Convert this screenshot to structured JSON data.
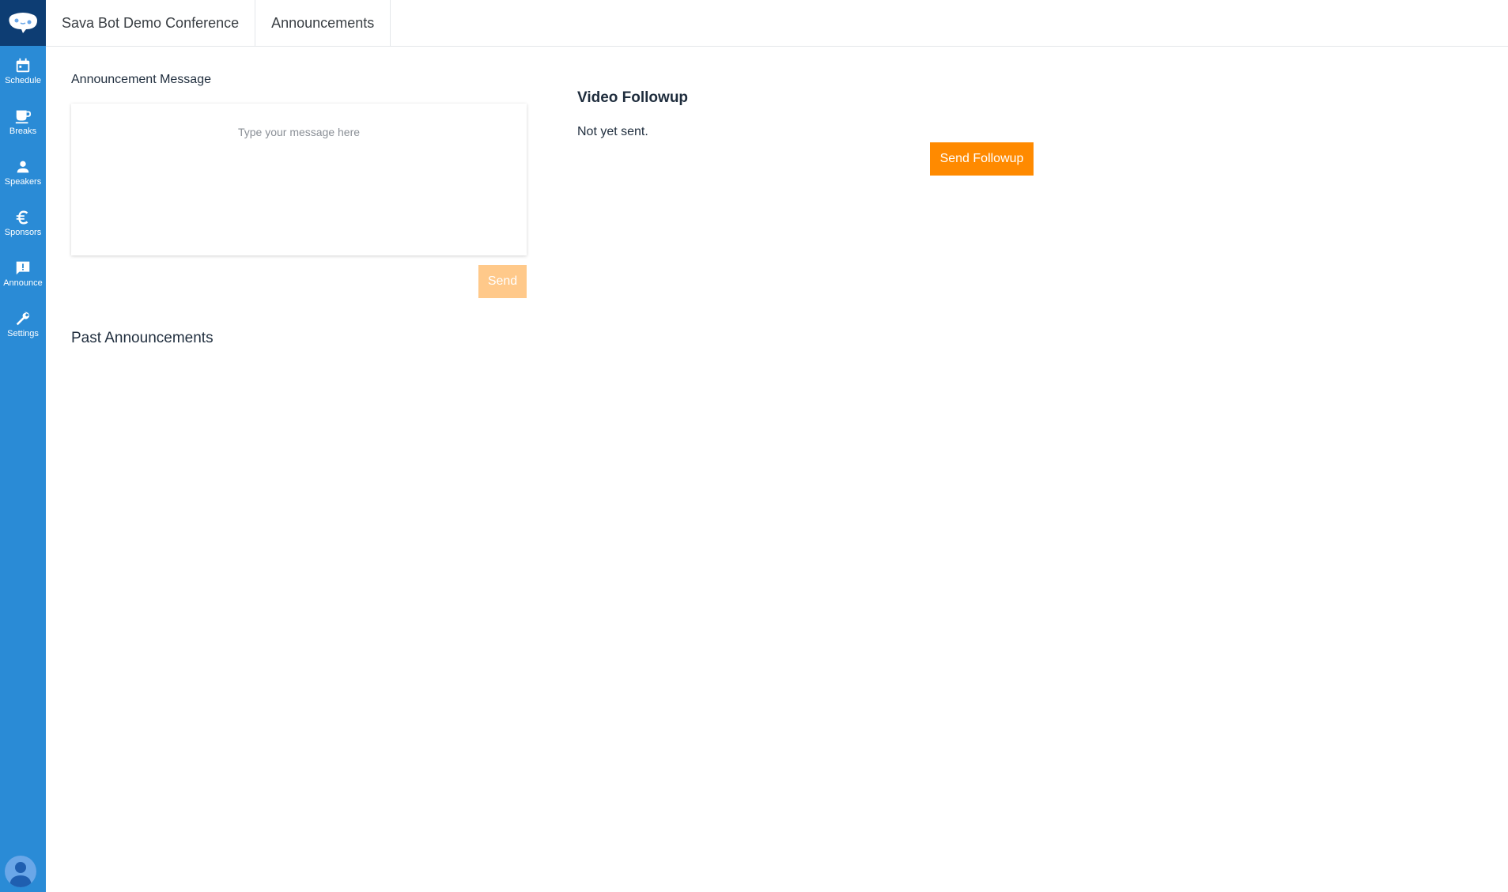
{
  "colors": {
    "sidebar": "#2a8bd6",
    "logo_bg": "#0d3d73",
    "accent": "#ff8a00",
    "accent_disabled": "#ffc98a"
  },
  "sidebar": {
    "logo_icon": "chat-bot-logo-icon",
    "items": [
      {
        "icon": "calendar-icon",
        "label": "Schedule"
      },
      {
        "icon": "coffee-cup-icon",
        "label": "Breaks"
      },
      {
        "icon": "person-icon",
        "label": "Speakers"
      },
      {
        "icon": "euro-icon",
        "label": "Sponsors"
      },
      {
        "icon": "announcement-icon",
        "label": "Announce"
      },
      {
        "icon": "wrench-icon",
        "label": "Settings"
      }
    ],
    "avatar_icon": "user-avatar-icon"
  },
  "topbar": {
    "tabs": [
      {
        "label": "Sava Bot Demo Conference"
      },
      {
        "label": "Announcements"
      }
    ]
  },
  "announcement": {
    "label": "Announcement Message",
    "placeholder": "Type your message here",
    "value": "",
    "send_label": "Send"
  },
  "past": {
    "title": "Past Announcements",
    "items": []
  },
  "video_followup": {
    "title": "Video Followup",
    "status": "Not yet sent.",
    "button_label": "Send Followup"
  }
}
